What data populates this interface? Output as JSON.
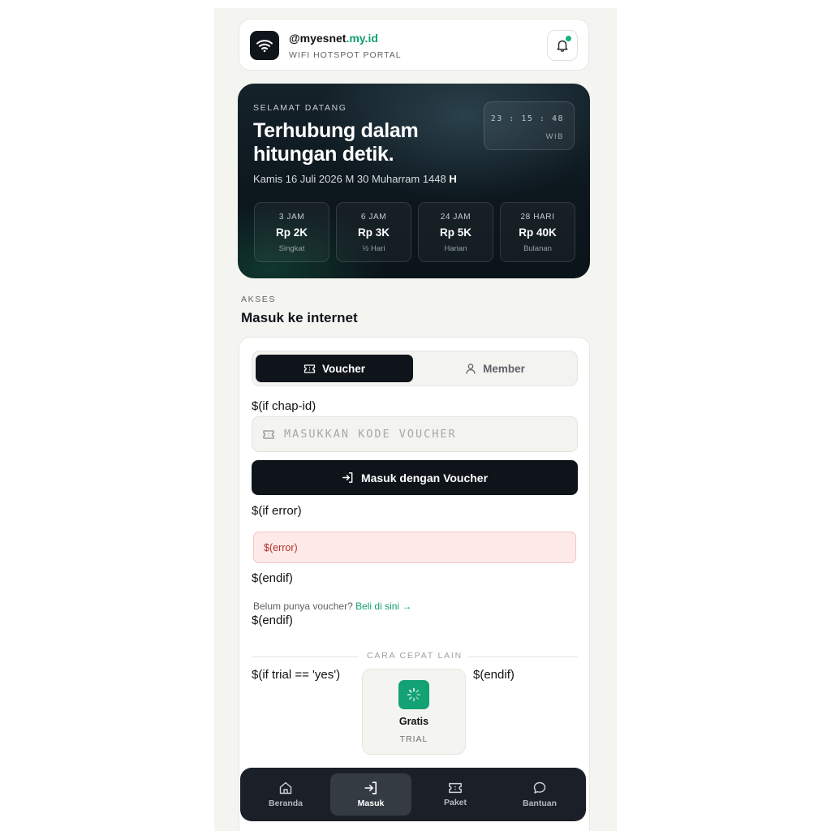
{
  "header": {
    "brand_main": "@myesnet",
    "brand_accent": ".my.id",
    "subtitle": "WIFI HOTSPOT PORTAL"
  },
  "hero": {
    "greeting": "SELAMAT DATANG",
    "title": "Terhubung dalam hitungan detik.",
    "date_text": "Kamis 16 Juli 2026 M 30 Muharram 1448 ",
    "date_suffix": "H",
    "clock_time": "23 : 15 : 48",
    "clock_zone": "WIB",
    "plans": [
      {
        "duration": "3 JAM",
        "price": "Rp 2K",
        "name": "Singkat"
      },
      {
        "duration": "6 JAM",
        "price": "Rp 3K",
        "name": "½ Hari"
      },
      {
        "duration": "24 JAM",
        "price": "Rp 5K",
        "name": "Harian"
      },
      {
        "duration": "28 HARI",
        "price": "Rp 40K",
        "name": "Bulanan"
      }
    ]
  },
  "section": {
    "label": "AKSES",
    "title": "Masuk ke internet"
  },
  "tabs": {
    "voucher": "Voucher",
    "member": "Member"
  },
  "template": {
    "if_chap": "$(if chap-id)",
    "if_error": "$(if error)",
    "endif_1": "$(endif)",
    "endif_2": "$(endif)",
    "if_trial": "$(if trial == 'yes')",
    "endif_3": "$(endif)"
  },
  "voucher_input": {
    "placeholder": "MASUKKAN KODE VOUCHER",
    "value": ""
  },
  "login_button": "Masuk dengan Voucher",
  "error_text": "$(error)",
  "buy": {
    "text": "Belum punya voucher? ",
    "link": "Beli di sini →"
  },
  "divider_text": "CARA CEPAT LAIN",
  "trial": {
    "name": "Gratis",
    "sub": "TRIAL"
  },
  "nav": {
    "items": [
      {
        "label": "Beranda",
        "icon": "home-icon"
      },
      {
        "label": "Masuk",
        "icon": "login-icon"
      },
      {
        "label": "Paket",
        "icon": "ticket-icon"
      },
      {
        "label": "Bantuan",
        "icon": "chat-icon"
      }
    ],
    "active": "Masuk"
  },
  "colors": {
    "accent": "#12a071",
    "dark": "#0f141b",
    "error_bg": "#fde9e8",
    "error_text": "#b4312b"
  }
}
